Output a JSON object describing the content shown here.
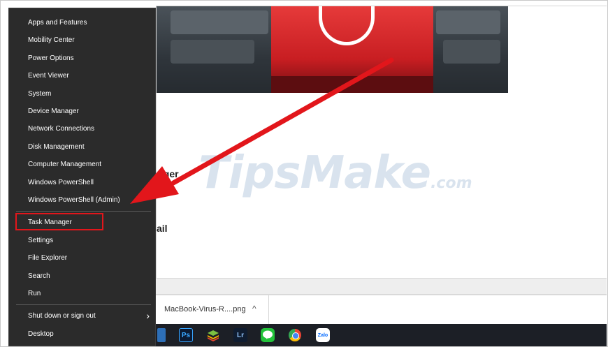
{
  "menu": {
    "groups": [
      {
        "items": [
          {
            "label": "Apps and Features"
          },
          {
            "label": "Mobility Center"
          },
          {
            "label": "Power Options"
          },
          {
            "label": "Event Viewer"
          },
          {
            "label": "System"
          },
          {
            "label": "Device Manager"
          },
          {
            "label": "Network Connections"
          },
          {
            "label": "Disk Management"
          },
          {
            "label": "Computer Management"
          },
          {
            "label": "Windows PowerShell"
          },
          {
            "label": "Windows PowerShell (Admin)"
          }
        ]
      },
      {
        "items": [
          {
            "label": "Task Manager",
            "highlighted": true
          },
          {
            "label": "Settings"
          },
          {
            "label": "File Explorer"
          },
          {
            "label": "Search"
          },
          {
            "label": "Run"
          }
        ]
      },
      {
        "items": [
          {
            "label": "Shut down or sign out",
            "submenu": true
          },
          {
            "label": "Desktop"
          }
        ]
      }
    ],
    "submenu_glyph": "›"
  },
  "page": {
    "fragment_1": "ager",
    "fragment_2": "ail"
  },
  "watermark": {
    "main": "TipsMake",
    "suffix": ".com"
  },
  "download_bar": {
    "file_name": "MacBook-Virus-R....png",
    "chevron": "^"
  },
  "taskbar": {
    "icons": [
      "mail-icon",
      "photoshop-icon",
      "bluestacks-icon",
      "lightroom-icon",
      "line-icon",
      "chrome-icon",
      "zalo-icon"
    ],
    "photoshop_label": "Ps",
    "lightroom_label": "Lr",
    "line_label": "LINE",
    "zalo_label": "Zalo"
  },
  "colors": {
    "menu_bg": "#2b2b2b",
    "highlight": "#e2161b",
    "arrow": "#e2161b",
    "watermark": "#d9e3ee"
  }
}
